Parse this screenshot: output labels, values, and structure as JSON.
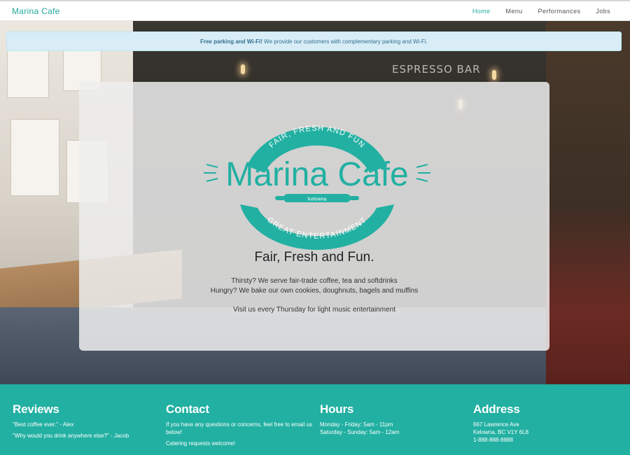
{
  "brand": "Marina Cafe",
  "nav": {
    "items": [
      "Home",
      "Menu",
      "Performances",
      "Jobs"
    ],
    "active": "Home"
  },
  "notice": {
    "bold": "Free parking and Wi-Fi!",
    "text": " We provide our customers with complementary parking and Wi-Fi."
  },
  "logo": {
    "top_arc": "FAIR, FRESH AND FUN",
    "name": "Marina Cafe",
    "place": "Kelowna",
    "bottom_arc": "GREAT ENTERTAINMENT",
    "color": "#22b0a2"
  },
  "card": {
    "headline": "Fair, Fresh and Fun.",
    "line1": "Thirsty? We serve fair-trade coffee, tea and softdrinks",
    "line2": "Hungry? We bake our own cookies, doughnuts, bagels and muffins",
    "visit": "Visit us every Thursday for light music entertainment"
  },
  "background": {
    "sign": "ESPRESSO BAR"
  },
  "footer": {
    "reviews": {
      "title": "Reviews",
      "r1": "\"Best coffee ever.\" - Alex",
      "r2": "\"Why would you drink anywhere else?\" - Jacob"
    },
    "contact": {
      "title": "Contact",
      "t1": "If you have any questions or concerns, feel free to email us below!",
      "t2": "Catering requests welcome!"
    },
    "hours": {
      "title": "Hours",
      "h1": "Monday - Friday: 5am - 11pm",
      "h2": "Saturday - Sunday: 5am - 12am"
    },
    "address": {
      "title": "Address",
      "a1": "667 Lawrence Ave",
      "a2": "Kelowna, BC V1Y 6L8",
      "a3": "1-888-888-8888"
    }
  }
}
